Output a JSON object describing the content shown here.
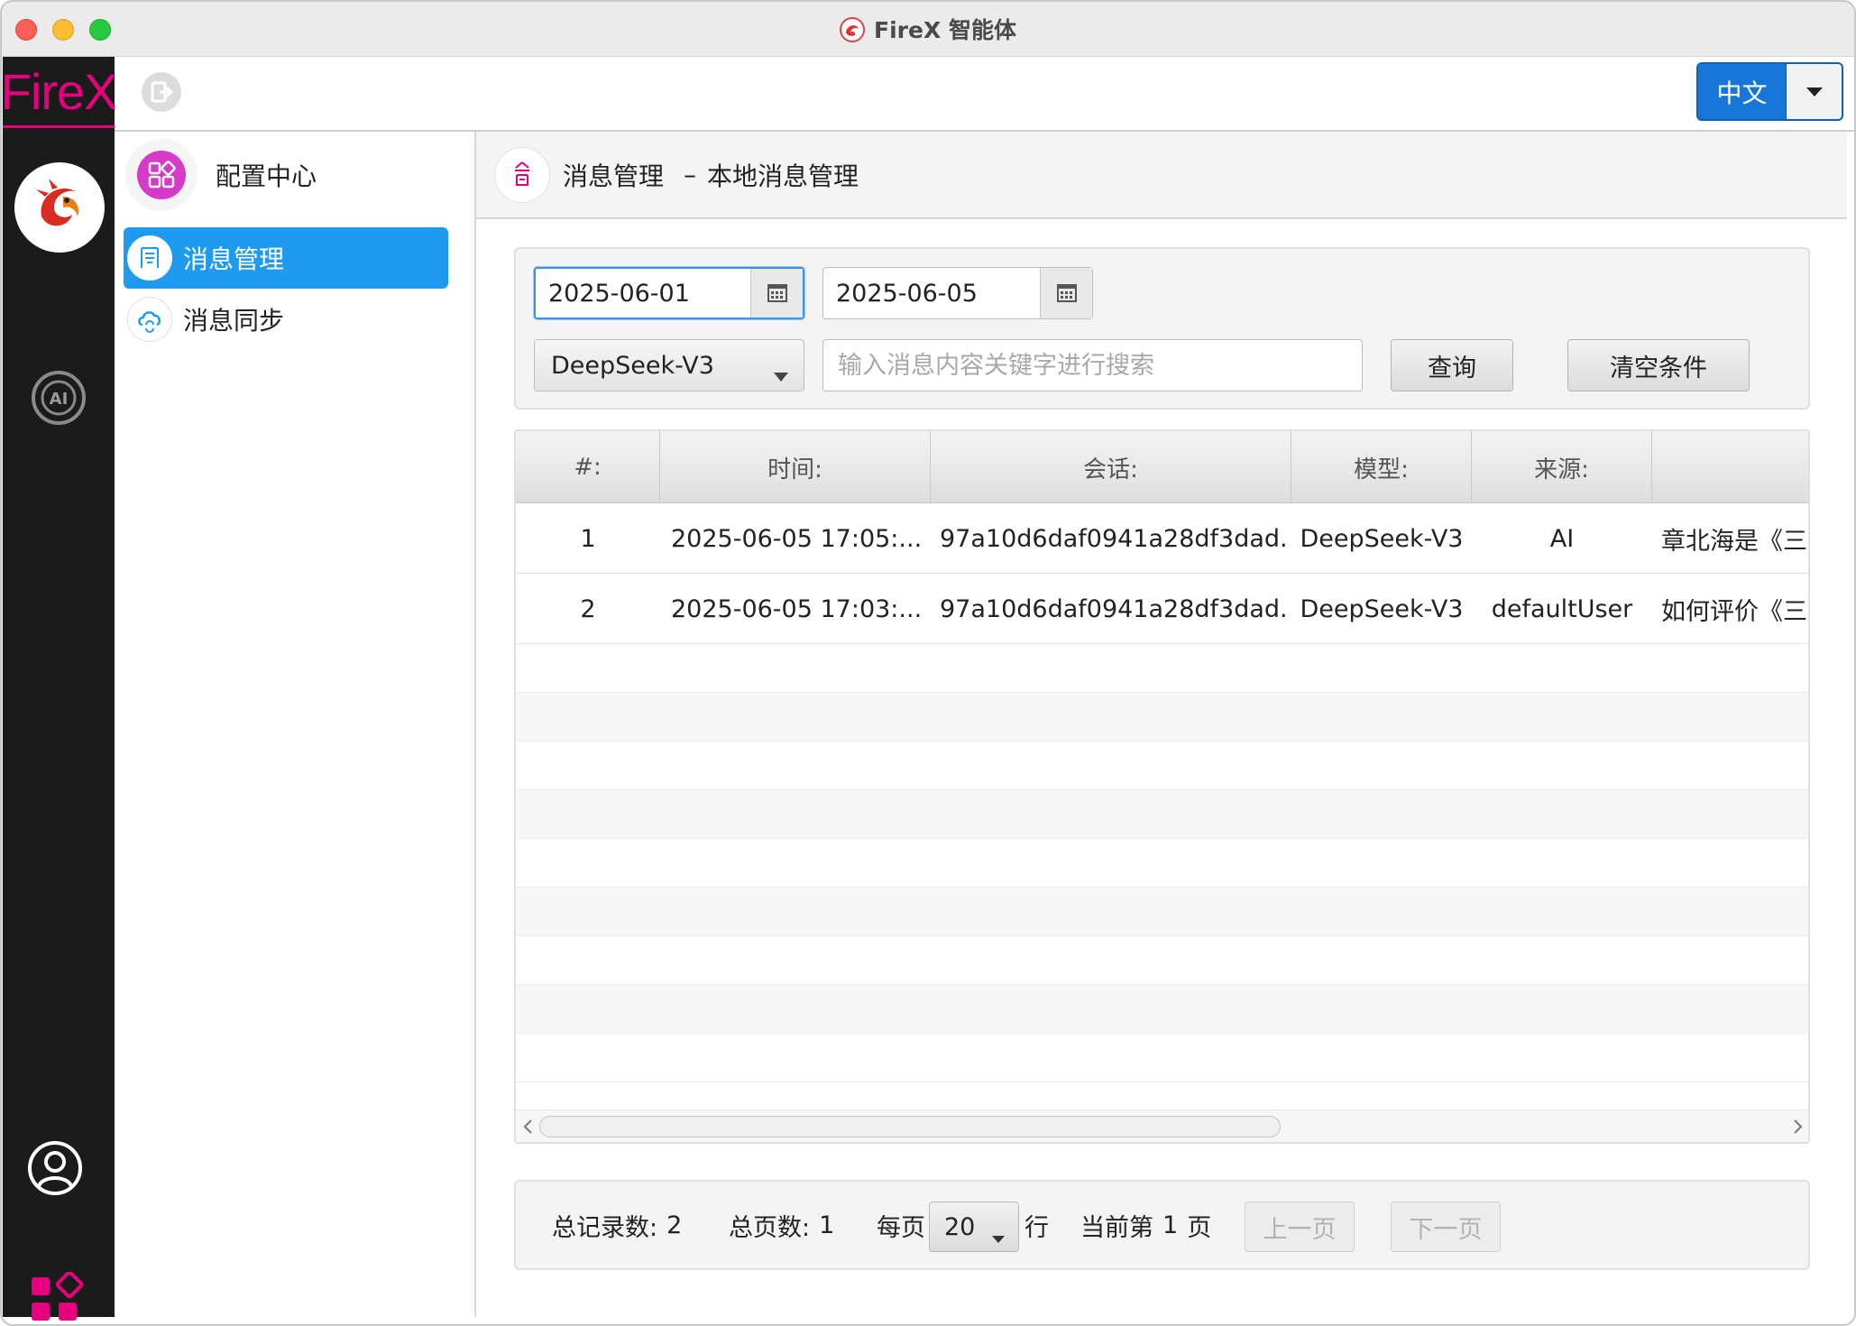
{
  "window": {
    "title": "FireX 智能体"
  },
  "rail": {
    "logo_text": "FireX"
  },
  "toolbar": {
    "language": "中文"
  },
  "sidebar": {
    "section_title": "配置中心",
    "items": [
      {
        "label": "消息管理",
        "active": true
      },
      {
        "label": "消息同步",
        "active": false
      }
    ]
  },
  "main": {
    "title": "消息管理",
    "separator": "–",
    "subtitle": "本地消息管理"
  },
  "filter": {
    "start_date": "2025-06-01",
    "end_date": "2025-06-05",
    "model": "DeepSeek-V3",
    "search_placeholder": "输入消息内容关键字进行搜索",
    "query_label": "查询",
    "clear_label": "清空条件"
  },
  "table": {
    "columns": [
      "#:",
      "时间:",
      "会话:",
      "模型:",
      "来源:"
    ],
    "rows": [
      {
        "index": "1",
        "time": "2025-06-05 17:05:...",
        "session": "97a10d6daf0941a28df3dad...",
        "model": "DeepSeek-V3",
        "source": "AI",
        "content": "章北海是《三"
      },
      {
        "index": "2",
        "time": "2025-06-05 17:03:...",
        "session": "97a10d6daf0941a28df3dad...",
        "model": "DeepSeek-V3",
        "source": "defaultUser",
        "content": "如何评价《三"
      }
    ]
  },
  "pager": {
    "total_records_label": "总记录数:",
    "total_records": "2",
    "total_pages_label": "总页数:",
    "total_pages": "1",
    "per_page_label": "每页",
    "per_page": "20",
    "rows_unit": "行",
    "current_prefix": "当前第",
    "current_page": "1",
    "current_suffix": "页",
    "prev_label": "上一页",
    "next_label": "下一页"
  },
  "colors": {
    "accent_blue": "#1677d9",
    "active_item": "#1e9bf0",
    "brand_magenta": "#e6007e",
    "rail_bg": "#1b1b1b"
  },
  "icons": {
    "title_logo": "dragon-logo-icon",
    "exit": "exit-icon",
    "dragon": "dragon-icon",
    "ai": "ai-icon",
    "user": "user-icon",
    "apps": "apps-icon",
    "config": "grid-config-icon",
    "message_manage": "message-manage-icon",
    "message_sync": "cloud-sync-icon",
    "calendar": "calendar-icon"
  }
}
